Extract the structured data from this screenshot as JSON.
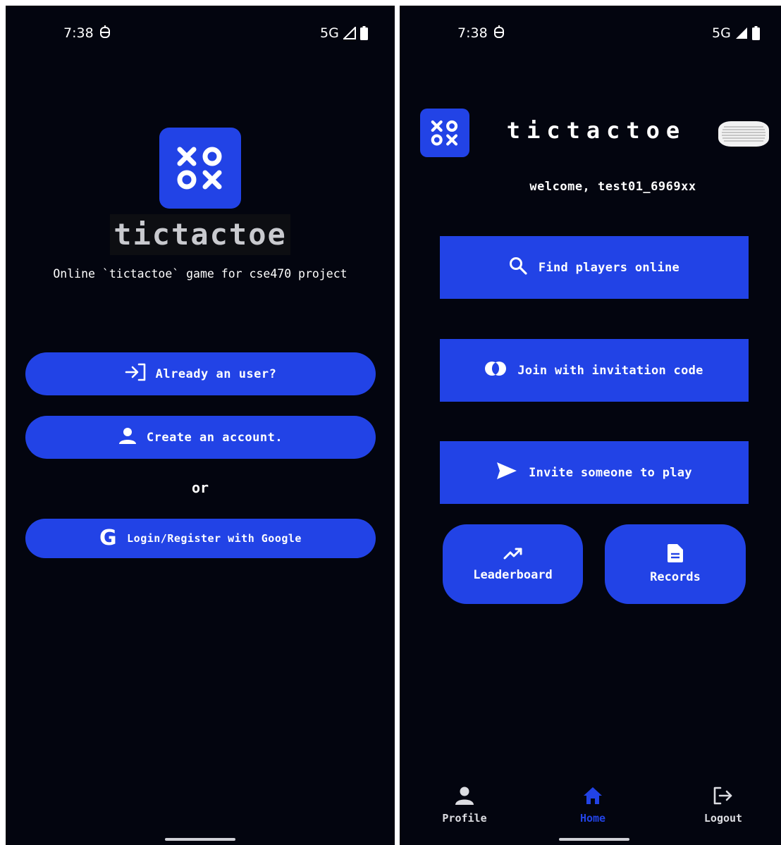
{
  "left_screen": {
    "status_bar": {
      "time": "7:38",
      "network": "5G"
    },
    "app_title": "tictactoe",
    "subtitle": "Online `tictactoe` game for cse470 project",
    "buttons": {
      "login": "Already an user?",
      "create_account": "Create an account.",
      "google": "Login/Register with Google"
    },
    "or_label": "or"
  },
  "right_screen": {
    "status_bar": {
      "time": "7:38",
      "network": "5G"
    },
    "app_title": "tictactoe",
    "welcome": "welcome, test01_6969xx",
    "buttons": {
      "find_players": "Find players online",
      "join_code": "Join with invitation code",
      "invite": "Invite someone to play",
      "leaderboard": "Leaderboard",
      "records": "Records"
    },
    "bottom_nav": {
      "profile": "Profile",
      "home": "Home",
      "logout": "Logout"
    }
  },
  "icons": {
    "logo": "xo-ox-icon",
    "login": "login-arrow-icon",
    "create_account": "person-icon",
    "google": "google-g-icon",
    "search": "search-icon",
    "join": "overlapping-circles-icon",
    "invite": "send-icon",
    "leaderboard": "trending-up-icon",
    "records": "document-icon",
    "profile": "person-icon",
    "home": "home-icon",
    "logout": "logout-icon"
  },
  "colors": {
    "background": "#03050f",
    "accent": "#2243e6",
    "text": "#ffffff",
    "nav_inactive": "#dcdde2"
  }
}
